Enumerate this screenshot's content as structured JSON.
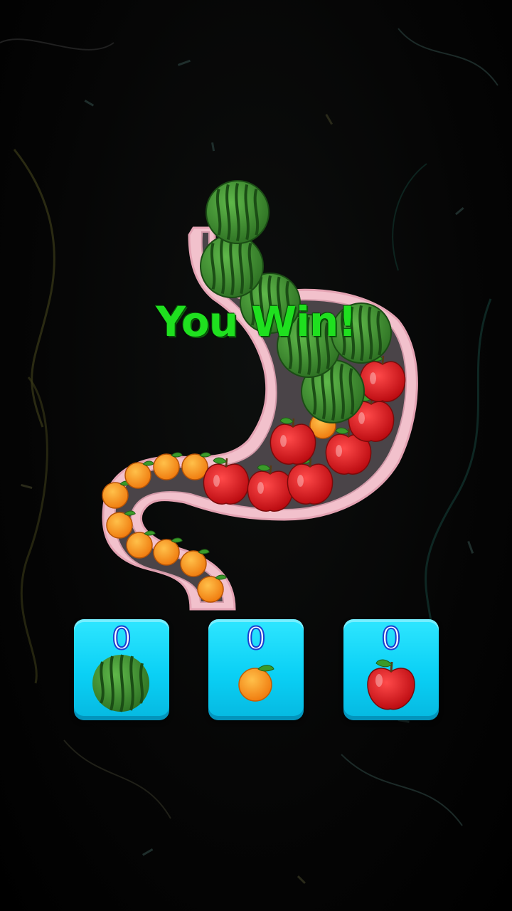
{
  "game": {
    "status_message": "You Win!"
  },
  "counters": [
    {
      "fruit": "watermelon",
      "icon": "watermelon-icon",
      "count": "0"
    },
    {
      "fruit": "orange",
      "icon": "orange-icon",
      "count": "0"
    },
    {
      "fruit": "apple",
      "icon": "apple-icon",
      "count": "0"
    }
  ],
  "colors": {
    "win_text": "#1fe01f",
    "counter_bg": "#0ad0f5",
    "stomach_outline": "#f2b8c6",
    "stomach_fill": "#4a4448",
    "watermelon": "#3f8f2f",
    "orange": "#f7941d",
    "apple": "#d8141c"
  }
}
